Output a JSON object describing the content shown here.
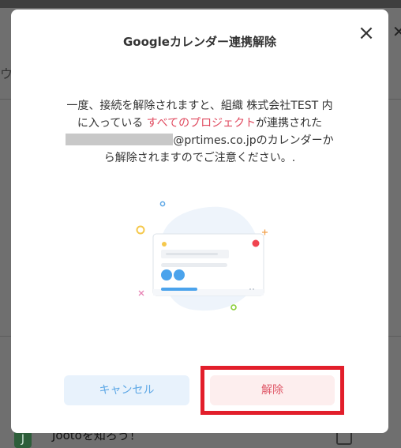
{
  "background": {
    "left_text": "ウ",
    "bottom_text": "Jootoを知ろう！",
    "avatar_letter": "J"
  },
  "modal": {
    "title": "Googleカレンダー連携解除",
    "close_icon": "close-icon",
    "message": {
      "part1": "一度、接続を解除されますと、組織 株式会社TEST 内に入っている ",
      "accent": "すべてのプロジェクト",
      "part2": "が連携された",
      "part3": "@prtimes.co.jpのカレンダーから解除されますのでご注意ください。."
    },
    "illustration": "calendar-card-illustration",
    "buttons": {
      "cancel_label": "キャンセル",
      "unlink_label": "解除"
    }
  },
  "colors": {
    "accent": "#e04a5f",
    "cancel_text": "#5ea8e6",
    "unlink_text": "#e05a6a",
    "highlight_border": "#e21e2b"
  }
}
